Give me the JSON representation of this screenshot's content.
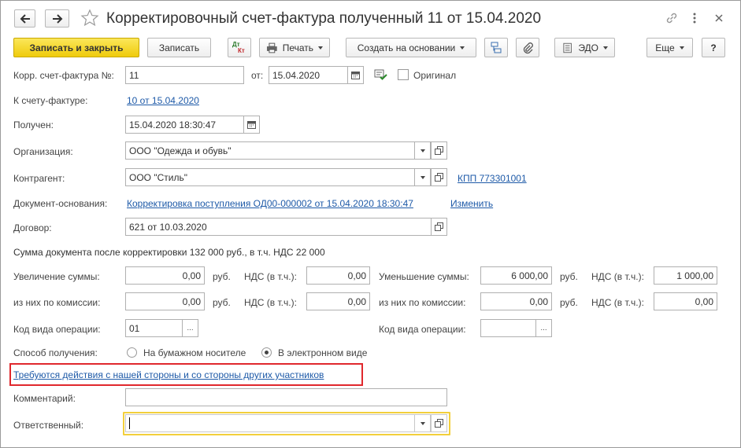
{
  "window": {
    "title": "Корректировочный счет-фактура полученный 11 от 15.04.2020"
  },
  "toolbar": {
    "save_close": "Записать и закрыть",
    "save": "Записать",
    "dtkt_top": "Дт",
    "dtkt_bottom": "Кт",
    "print": "Печать",
    "create_based": "Создать на основании",
    "edo": "ЭДО",
    "more": "Еще",
    "help": "?"
  },
  "form": {
    "corr_number_label": "Корр. счет-фактура №:",
    "corr_number_value": "11",
    "from_label": "от:",
    "from_value": "15.04.2020",
    "original_label": "Оригинал",
    "to_invoice_label": "К счету-фактуре:",
    "to_invoice_link": "10 от 15.04.2020",
    "received_label": "Получен:",
    "received_value": "15.04.2020 18:30:47",
    "org_label": "Организация:",
    "org_value": "ООО \"Одежда и обувь\"",
    "contractor_label": "Контрагент:",
    "contractor_value": "ООО \"Стиль\"",
    "kpp_link": "КПП 773301001",
    "basis_label": "Документ-основания:",
    "basis_link": "Корректировка поступления ОД00-000002 от 15.04.2020 18:30:47",
    "change_link": "Изменить",
    "contract_label": "Договор:",
    "contract_value": "621 от 10.03.2020",
    "sum_text": "Сумма документа после корректировки 132 000 руб., в т.ч. НДС 22 000",
    "increase_label": "Увеличение суммы:",
    "increase_value": "0,00",
    "rub": "руб.",
    "vat_label": "НДС (в т.ч.):",
    "increase_vat_value": "0,00",
    "decrease_label": "Уменьшение суммы:",
    "decrease_value": "6 000,00",
    "decrease_vat_value": "1 000,00",
    "commission_label": "из них по комиссии:",
    "inc_comm_value": "0,00",
    "inc_comm_vat_value": "0,00",
    "dec_comm_value": "0,00",
    "dec_comm_vat_value": "0,00",
    "op_code_label": "Код вида операции:",
    "op_code_value": "01",
    "op_code2_label": "Код вида операции:",
    "op_code2_value": "",
    "dots": "...",
    "method_label": "Способ получения:",
    "paper_label": "На бумажном носителе",
    "electronic_label": "В электронном виде",
    "actions_link": "Требуются действия с нашей стороны и со стороны других участников",
    "comment_label": "Комментарий:",
    "comment_value": "",
    "responsible_label": "Ответственный:",
    "responsible_value": ""
  }
}
